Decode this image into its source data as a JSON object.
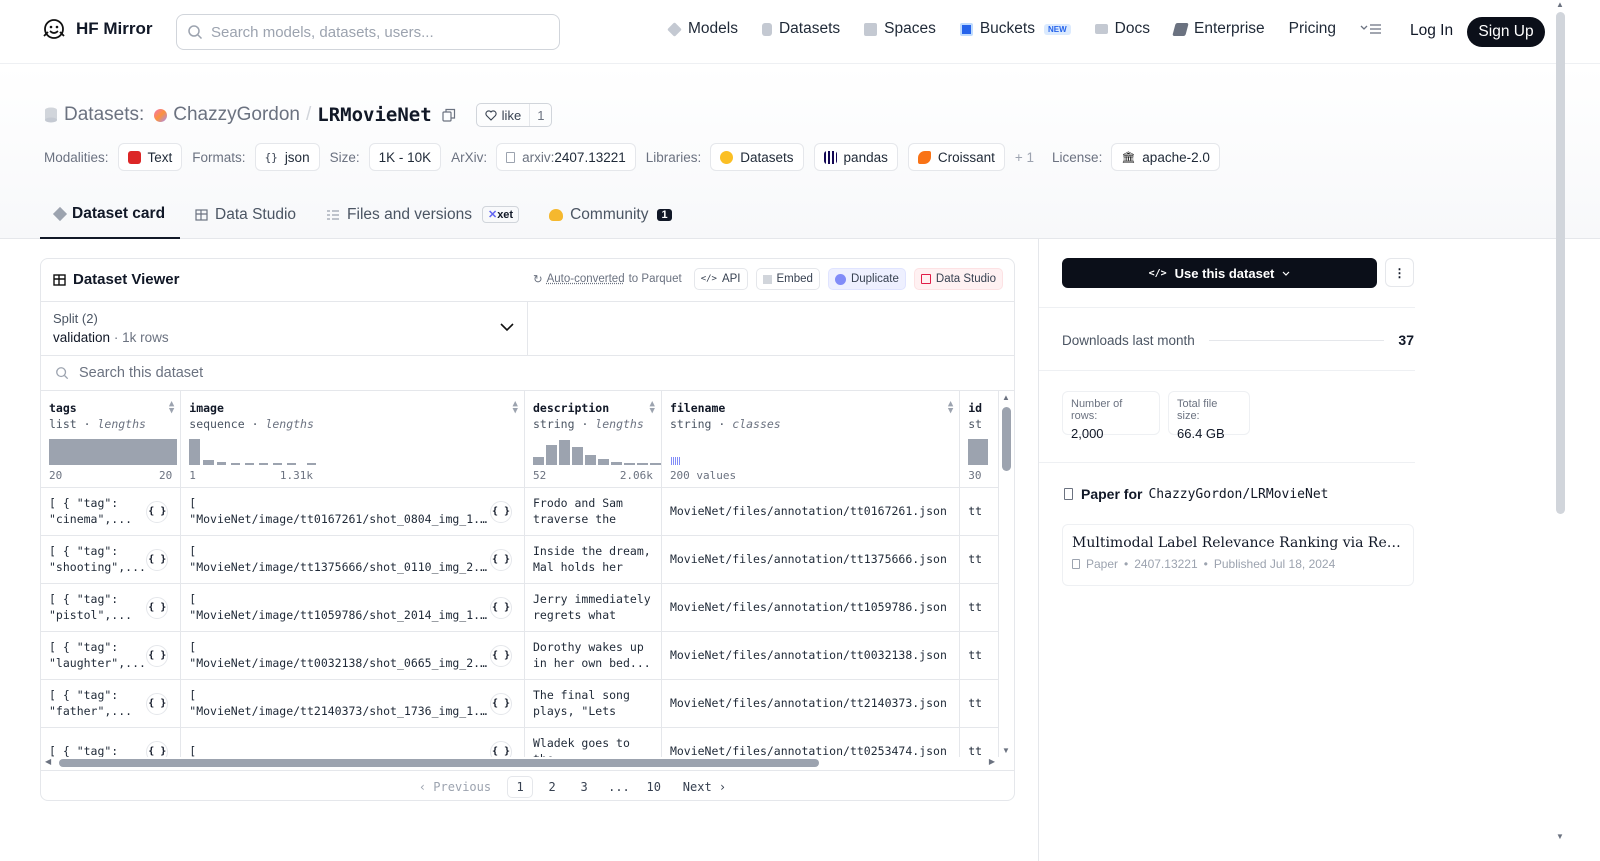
{
  "nav": {
    "brand": "HF Mirror",
    "search_placeholder": "Search models, datasets, users...",
    "links": [
      {
        "label": "Models",
        "icon": "cube-icon",
        "color": "#9ca3af"
      },
      {
        "label": "Datasets",
        "icon": "database-icon",
        "color": "#9ca3af"
      },
      {
        "label": "Spaces",
        "icon": "grid-icon",
        "color": "#9ca3af"
      },
      {
        "label": "Buckets",
        "icon": "bucket-icon",
        "color": "#2563eb"
      },
      {
        "label": "Docs",
        "icon": "book-icon",
        "color": "#9ca3af"
      },
      {
        "label": "Enterprise",
        "icon": "enterprise-icon",
        "color": "#9ca3af"
      },
      {
        "label": "Pricing"
      }
    ],
    "buckets_badge": "NEW",
    "login": "Log In",
    "signup": "Sign Up"
  },
  "header": {
    "type_label": "Datasets:",
    "org": "ChazzyGordon",
    "separator": "/",
    "name": "LRMovieNet",
    "like_label": "like",
    "like_count": "1",
    "meta": {
      "modalities_label": "Modalities:",
      "modality": "Text",
      "formats_label": "Formats:",
      "format": "json",
      "size_label": "Size:",
      "size": "1K - 10K",
      "arxiv_label": "ArXiv:",
      "arxiv_prefix": "arxiv:",
      "arxiv": "2407.13221",
      "libraries_label": "Libraries:",
      "libraries": [
        "Datasets",
        "pandas",
        "Croissant"
      ],
      "libraries_more": "+ 1",
      "license_label": "License:",
      "license": "apache-2.0"
    },
    "tabs": [
      "Dataset card",
      "Data Studio",
      "Files and versions",
      "Community"
    ],
    "xet_badge": "xet",
    "community_count": "1"
  },
  "viewer": {
    "title": "Dataset Viewer",
    "autoconv_link": "Auto-converted",
    "autoconv_rest": "to Parquet",
    "actions": [
      "API",
      "Embed",
      "Duplicate",
      "Data Studio"
    ],
    "split_label": "Split (2)",
    "split_value": "validation",
    "split_rows": "1k rows",
    "search_placeholder": "Search this dataset",
    "columns": [
      {
        "name": "tags",
        "type": "list",
        "stat": "lengths",
        "min": "20",
        "max": "20"
      },
      {
        "name": "image",
        "type": "sequence",
        "stat": "lengths",
        "min": "1",
        "max": "1.31k"
      },
      {
        "name": "description",
        "type": "string",
        "stat": "lengths",
        "min": "52",
        "max": "2.06k"
      },
      {
        "name": "filename",
        "type": "string",
        "stat": "classes",
        "min": "200 values",
        "max": ""
      },
      {
        "name": "id",
        "type": "st",
        "stat": "",
        "min": "30",
        "max": ""
      }
    ],
    "rows": [
      {
        "tags": "[ { \"tag\":\n\"cinema\",...",
        "image": "[\n\"MovieNet/image/tt0167261/shot_0804_img_1...",
        "description": "Frodo and Sam traverse the Dead...",
        "filename": "MovieNet/files/annotation/tt0167261.json",
        "id": "tt"
      },
      {
        "tags": "[ { \"tag\":\n\"shooting\",...",
        "image": "[\n\"MovieNet/image/tt1375666/shot_0110_img_2...",
        "description": "Inside the dream, Mal holds her gun...",
        "filename": "MovieNet/files/annotation/tt1375666.json",
        "id": "tt"
      },
      {
        "tags": "[ { \"tag\":\n\"pistol\",...",
        "image": "[\n\"MovieNet/image/tt1059786/shot_2014_img_1...",
        "description": "Jerry immediately regrets what he...",
        "filename": "MovieNet/files/annotation/tt1059786.json",
        "id": "tt"
      },
      {
        "tags": "[ { \"tag\":\n\"laughter\",...",
        "image": "[\n\"MovieNet/image/tt0032138/shot_0665_img_2...",
        "description": "Dorothy wakes up in her own bed...",
        "filename": "MovieNet/files/annotation/tt0032138.json",
        "id": "tt"
      },
      {
        "tags": "[ { \"tag\":\n\"father\",...",
        "image": "[\n\"MovieNet/image/tt2140373/shot_1736_img_1...",
        "description": "The final song plays, \"Lets Go...",
        "filename": "MovieNet/files/annotation/tt2140373.json",
        "id": "tt"
      },
      {
        "tags": "[ { \"tag\":",
        "image": "[",
        "description": "Wladek goes to the",
        "filename": "MovieNet/files/annotation/tt0253474.json",
        "id": "tt"
      }
    ],
    "json_button": "{ }",
    "pagination": {
      "prev": "Previous",
      "pages": [
        "1",
        "2",
        "3",
        "...",
        "10"
      ],
      "next": "Next",
      "current": "1"
    }
  },
  "sidebar": {
    "use_button": "Use this dataset",
    "downloads_label": "Downloads last month",
    "downloads": "37",
    "rows_label": "Number of rows:",
    "rows": "2,000",
    "filesize_label": "Total file size:",
    "filesize": "66.4 GB",
    "paper_for": "Paper for",
    "paper_repo": "ChazzyGordon/LRMovieNet",
    "paper_title": "Multimodal Label Relevance Ranking via Reinforcement Learning",
    "paper_kind": "Paper",
    "paper_id": "2407.13221",
    "paper_published": "Published Jul 18, 2024"
  },
  "colors": {
    "primary_dark": "#0b0f19",
    "border": "#e5e7eb",
    "histogram": "#9ca3af",
    "community_emoji": "#f5b82e"
  }
}
